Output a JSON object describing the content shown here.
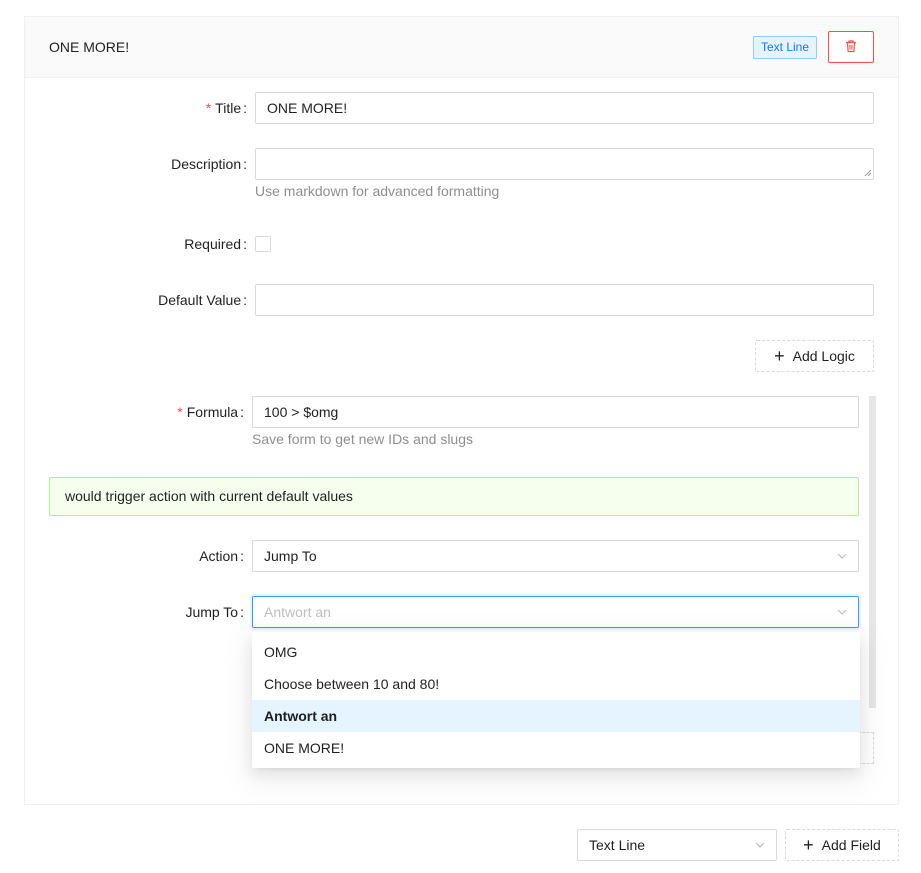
{
  "card": {
    "title": "ONE MORE!",
    "type_tag": "Text Line",
    "delete_icon": "trash-icon"
  },
  "fields": {
    "title": {
      "label": "Title",
      "required": true,
      "value": "ONE MORE!"
    },
    "description": {
      "label": "Description",
      "value": "",
      "help": "Use markdown for advanced formatting"
    },
    "required": {
      "label": "Required",
      "checked": false
    },
    "default_value": {
      "label": "Default Value",
      "value": ""
    }
  },
  "add_logic_label": "Add Logic",
  "logic": {
    "formula": {
      "label": "Formula",
      "required": true,
      "value": "100 > $omg",
      "help": "Save form to get new IDs and slugs"
    },
    "alert": "would trigger action with current default values",
    "action": {
      "label": "Action",
      "value": "Jump To"
    },
    "jump_to": {
      "label": "Jump To",
      "placeholder": "Antwort an"
    },
    "dropdown_options": [
      {
        "label": "OMG",
        "active": false
      },
      {
        "label": "Choose between 10 and 80!",
        "active": false
      },
      {
        "label": "Antwort an",
        "active": true
      },
      {
        "label": "ONE MORE!",
        "active": false
      }
    ]
  },
  "footer": {
    "field_type_value": "Text Line",
    "add_field_label": "Add Field"
  },
  "colors": {
    "primary": "#1677ff",
    "danger": "#ff4d4f",
    "success_bg": "#f6ffed",
    "success_border": "#b7eb8f",
    "active_option_bg": "#e6f4ff"
  }
}
